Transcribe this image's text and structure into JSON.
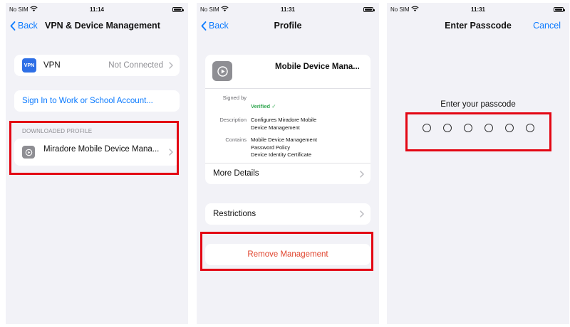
{
  "status": {
    "carrier": "No SIM",
    "times": [
      "11:14",
      "11:31",
      "11:31"
    ]
  },
  "screen1": {
    "back_label": "Back",
    "title": "VPN & Device Management",
    "vpn_icon_text": "VPN",
    "vpn_label": "VPN",
    "vpn_status": "Not Connected",
    "sign_in_label": "Sign In to Work or School Account...",
    "section_header": "DOWNLOADED PROFILE",
    "profile_label": "Miradore Mobile Device Mana..."
  },
  "screen2": {
    "back_label": "Back",
    "title": "Profile",
    "profile_name": "Mobile Device Mana...",
    "signed_by_key": "Signed by",
    "signed_by_value": "Verified",
    "description_key": "Description",
    "description_lines": [
      "Configures Miradore Mobile",
      "Device Management"
    ],
    "contains_key": "Contains",
    "contains_lines": [
      "Mobile Device Management",
      "Password Policy",
      "Device Identity Certificate"
    ],
    "more_details_label": "More Details",
    "restrictions_label": "Restrictions",
    "remove_label": "Remove Management"
  },
  "screen3": {
    "title": "Enter Passcode",
    "cancel_label": "Cancel",
    "prompt": "Enter your passcode",
    "digit_count": 6
  },
  "colors": {
    "accent": "#0a7aff",
    "highlight": "#e30613",
    "destructive": "#e0452f",
    "verified": "#34a853",
    "background": "#f2f2f7"
  }
}
